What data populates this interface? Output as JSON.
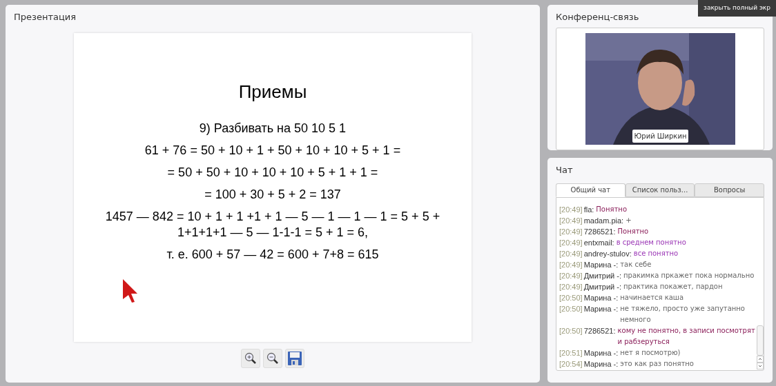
{
  "presentation": {
    "title": "Презентация",
    "slide": {
      "heading": "Приемы",
      "lines": [
        "9) Разбивать на 50 10 5 1",
        "61 + 76 = 50 + 10 + 1 + 50 + 10 + 10 + 5 + 1 =",
        "= 50 + 50 + 10 + 10 + 10 + 5 + 1 + 1 =",
        "= 100 + 30 + 5 + 2 = 137",
        "1457 — 842 = 10 + 1 + 1 +1 + 1 — 5 — 1 — 1 — 1 = 5 + 5  + 1+1+1+1  — 5 — 1-1-1 = 5 + 1 = 6,",
        "т. е. 600  + 57 — 42 = 600 + 7+8 = 615"
      ]
    },
    "tools": [
      {
        "kind": "zoom-in"
      },
      {
        "kind": "zoom-out"
      },
      {
        "kind": "save"
      }
    ]
  },
  "fullscreen_tooltip": "закрыть полный экр",
  "conference": {
    "title": "Конференц-связь",
    "video": {
      "kind": "picture",
      "speaker": "Юрий Ширкин"
    }
  },
  "chat": {
    "title": "Чат",
    "tabs": [
      {
        "label": "Общий чат",
        "selected": true
      },
      {
        "label": "Список польз...",
        "selected": false
      },
      {
        "label": "Вопросы",
        "selected": false
      }
    ],
    "messages": [
      {
        "time": "[20:49]",
        "user": "fla:",
        "text": "Понятно",
        "color": "#8b1f5a"
      },
      {
        "time": "[20:49]",
        "user": "madam.pia:",
        "text": "+",
        "color": "#666666"
      },
      {
        "time": "[20:49]",
        "user": "7286521:",
        "text": "Понятно",
        "color": "#8b1f5a"
      },
      {
        "time": "[20:49]",
        "user": "entxmail:",
        "text": "в среднем понятно",
        "color": "#9a35b5"
      },
      {
        "time": "[20:49]",
        "user": "andrey-stulov:",
        "text": "все понятно",
        "color": "#9a35b5"
      },
      {
        "time": "[20:49]",
        "user": "Марина -:",
        "text": "так себе",
        "color": "#666666"
      },
      {
        "time": "[20:49]",
        "user": "Дмитрий -:",
        "text": "пракимка пркажет пока нормально",
        "color": "#666666"
      },
      {
        "time": "[20:49]",
        "user": "Дмитрий -:",
        "text": "практика покажет, пардон",
        "color": "#666666"
      },
      {
        "time": "[20:50]",
        "user": "Марина -:",
        "text": "начинается каша",
        "color": "#666666"
      },
      {
        "time": "[20:50]",
        "user": "Марина -:",
        "text": "не тяжело, просто уже запутанно немного",
        "color": "#666666"
      },
      {
        "time": "[20:50]",
        "user": "7286521:",
        "text": "кому не понятно, в записи посмотрят и рабзеруться",
        "color": "#8b1f5a"
      },
      {
        "time": "[20:51]",
        "user": "Марина -:",
        "text": "нет я посмотрю)",
        "color": "#666666"
      },
      {
        "time": "[20:54]",
        "user": "Марина -:",
        "text": "это как раз понятно",
        "color": "#666666"
      }
    ]
  }
}
